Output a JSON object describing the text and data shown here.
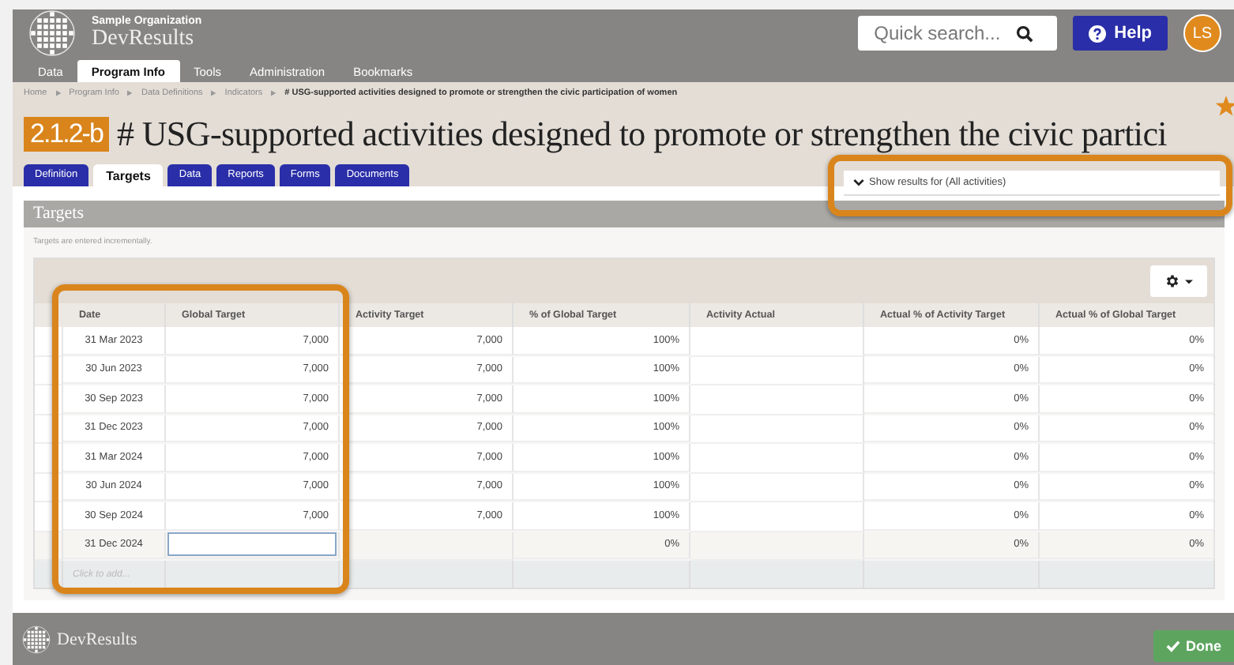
{
  "header": {
    "organization": "Sample Organization",
    "app_name": "DevResults",
    "search": {
      "placeholder": "Quick search..."
    },
    "help_label": "Help",
    "avatar_initials": "LS"
  },
  "nav": [
    {
      "label": "Data",
      "selected": false
    },
    {
      "label": "Program Info",
      "selected": true
    },
    {
      "label": "Tools",
      "selected": false
    },
    {
      "label": "Administration",
      "selected": false
    },
    {
      "label": "Bookmarks",
      "selected": false
    }
  ],
  "breadcrumb": [
    "Home",
    "Program Info",
    "Data Definitions",
    "Indicators",
    "# USG-supported activities designed to promote or strengthen the civic participation of women"
  ],
  "indicator": {
    "code": "2.1.2-b",
    "title": "# USG-supported activities designed to promote or strengthen the civic partici",
    "starred": true
  },
  "tabs": [
    {
      "label": "Definition",
      "selected": false
    },
    {
      "label": "Targets",
      "selected": true
    },
    {
      "label": "Data",
      "selected": false
    },
    {
      "label": "Reports",
      "selected": false
    },
    {
      "label": "Forms",
      "selected": false
    },
    {
      "label": "Documents",
      "selected": false
    }
  ],
  "results_filter": {
    "label": "Show results for (All activities)",
    "highlighted": true
  },
  "targets_panel": {
    "title": "Targets",
    "note": "Targets are entered incrementally.",
    "date_and_global_target_highlighted": true,
    "columns": [
      "Date",
      "Global Target",
      "Activity Target",
      "% of Global Target",
      "Activity Actual",
      "Actual % of Activity Target",
      "Actual % of Global Target"
    ],
    "rows": [
      {
        "kind": "saved",
        "date": "31 Mar 2023",
        "global_target": "7,000",
        "activity_target": "7,000",
        "pct_global": "100%",
        "actual_pct_activity": "0%",
        "actual_pct_global": "0%"
      },
      {
        "kind": "saved",
        "date": "30 Jun 2023",
        "global_target": "7,000",
        "activity_target": "7,000",
        "pct_global": "100%",
        "actual_pct_activity": "0%",
        "actual_pct_global": "0%"
      },
      {
        "kind": "saved",
        "date": "30 Sep 2023",
        "global_target": "7,000",
        "activity_target": "7,000",
        "pct_global": "100%",
        "actual_pct_activity": "0%",
        "actual_pct_global": "0%"
      },
      {
        "kind": "saved",
        "date": "31 Dec 2023",
        "global_target": "7,000",
        "activity_target": "7,000",
        "pct_global": "100%",
        "actual_pct_activity": "0%",
        "actual_pct_global": "0%"
      },
      {
        "kind": "saved",
        "date": "31 Mar 2024",
        "global_target": "7,000",
        "activity_target": "7,000",
        "pct_global": "100%",
        "actual_pct_activity": "0%",
        "actual_pct_global": "0%"
      },
      {
        "kind": "saved",
        "date": "30 Jun 2024",
        "global_target": "7,000",
        "activity_target": "7,000",
        "pct_global": "100%",
        "actual_pct_activity": "0%",
        "actual_pct_global": "0%"
      },
      {
        "kind": "saved",
        "date": "30 Sep 2024",
        "global_target": "7,000",
        "activity_target": "7,000",
        "pct_global": "100%",
        "actual_pct_activity": "0%",
        "actual_pct_global": "0%"
      },
      {
        "kind": "editing",
        "date": "31 Dec 2024",
        "pct_global": "0%",
        "actual_pct_activity": "0%",
        "actual_pct_global": "0%"
      }
    ],
    "add_row": {
      "placeholder": "Click to add..."
    }
  },
  "footer": {
    "app_name": "DevResults",
    "done_label": "Done"
  }
}
